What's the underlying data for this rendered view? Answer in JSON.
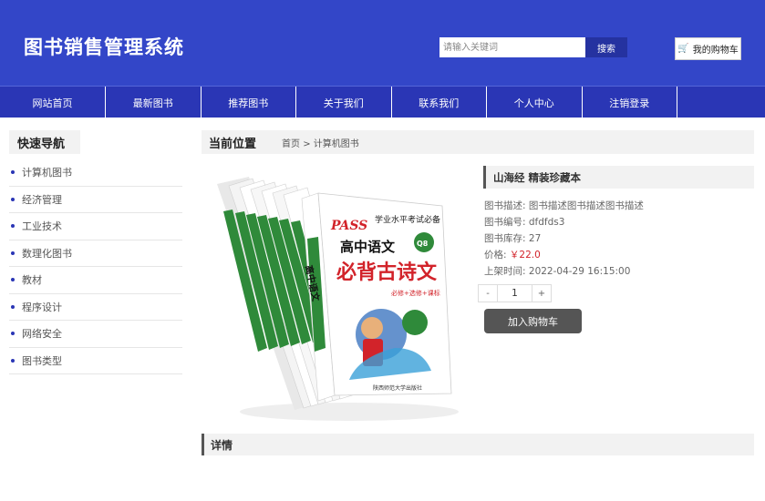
{
  "header": {
    "site_title": "图书销售管理系统",
    "search_placeholder": "请输入关键词",
    "search_label": "搜索",
    "cart_label": "我的购物车"
  },
  "nav": {
    "items": [
      "网站首页",
      "最新图书",
      "推荐图书",
      "关于我们",
      "联系我们",
      "个人中心",
      "注销登录"
    ]
  },
  "sidebar": {
    "title": "快速导航",
    "items": [
      "计算机图书",
      "经济管理",
      "工业技术",
      "数理化图书",
      "教材",
      "程序设计",
      "网络安全",
      "图书类型"
    ]
  },
  "breadcrumb": {
    "title": "当前位置",
    "path": "首页 > 计算机图书"
  },
  "product": {
    "image_texts": {
      "brand": "PASS",
      "series": "学业水平考试必备",
      "title_top": "高中语文",
      "title_main": "必背古诗文",
      "subtitle": "必修+选修+课标",
      "badge": "Q8",
      "spine": "高中语文",
      "publisher": "陕西师范大学出版社"
    },
    "name": "山海经 精装珍藏本",
    "desc_label": "图书描述:",
    "desc_value": "图书描述图书描述图书描述",
    "code_label": "图书编号:",
    "code_value": "dfdfds3",
    "stock_label": "图书库存:",
    "stock_value": "27",
    "price_label": "价格:",
    "price_value": "￥22.0",
    "date_label": "上架时间:",
    "date_value": "2022-04-29 16:15:00",
    "qty_minus": "-",
    "qty_value": "1",
    "qty_plus": "+",
    "add_cart_label": "加入购物车"
  },
  "detail": {
    "title": "详情"
  },
  "colors": {
    "header_bg": "#3346c8",
    "nav_bg": "#2a36b5",
    "price": "#d2232a",
    "button_dark": "#555555"
  }
}
